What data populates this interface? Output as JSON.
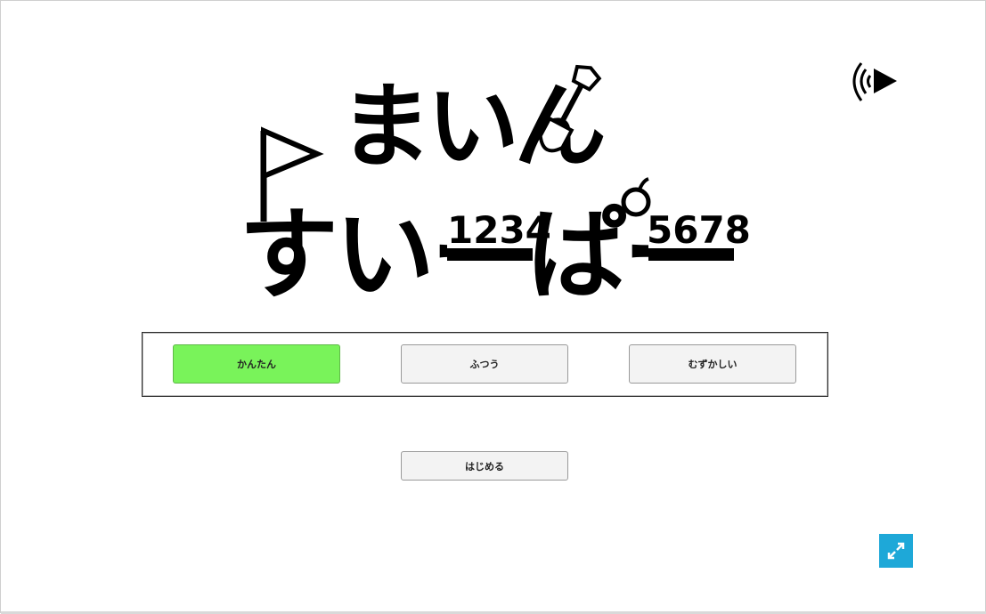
{
  "title": {
    "line1": "まいん",
    "line2": "すいーぱー",
    "num_left": "1234",
    "num_right": "5678"
  },
  "icons": {
    "sound": "sound-on-play-icon",
    "shovel": "shovel-icon",
    "flag": "flag-icon",
    "bomb": "bomb-icon",
    "fullscreen": "fullscreen-icon"
  },
  "difficulty": {
    "selected": "かんたん",
    "options": [
      "かんたん",
      "ふつう",
      "むずかしい"
    ]
  },
  "start_label": "はじめる",
  "colors": {
    "selected_button": "#79f35a",
    "fullscreen_button": "#1ea8d8"
  }
}
